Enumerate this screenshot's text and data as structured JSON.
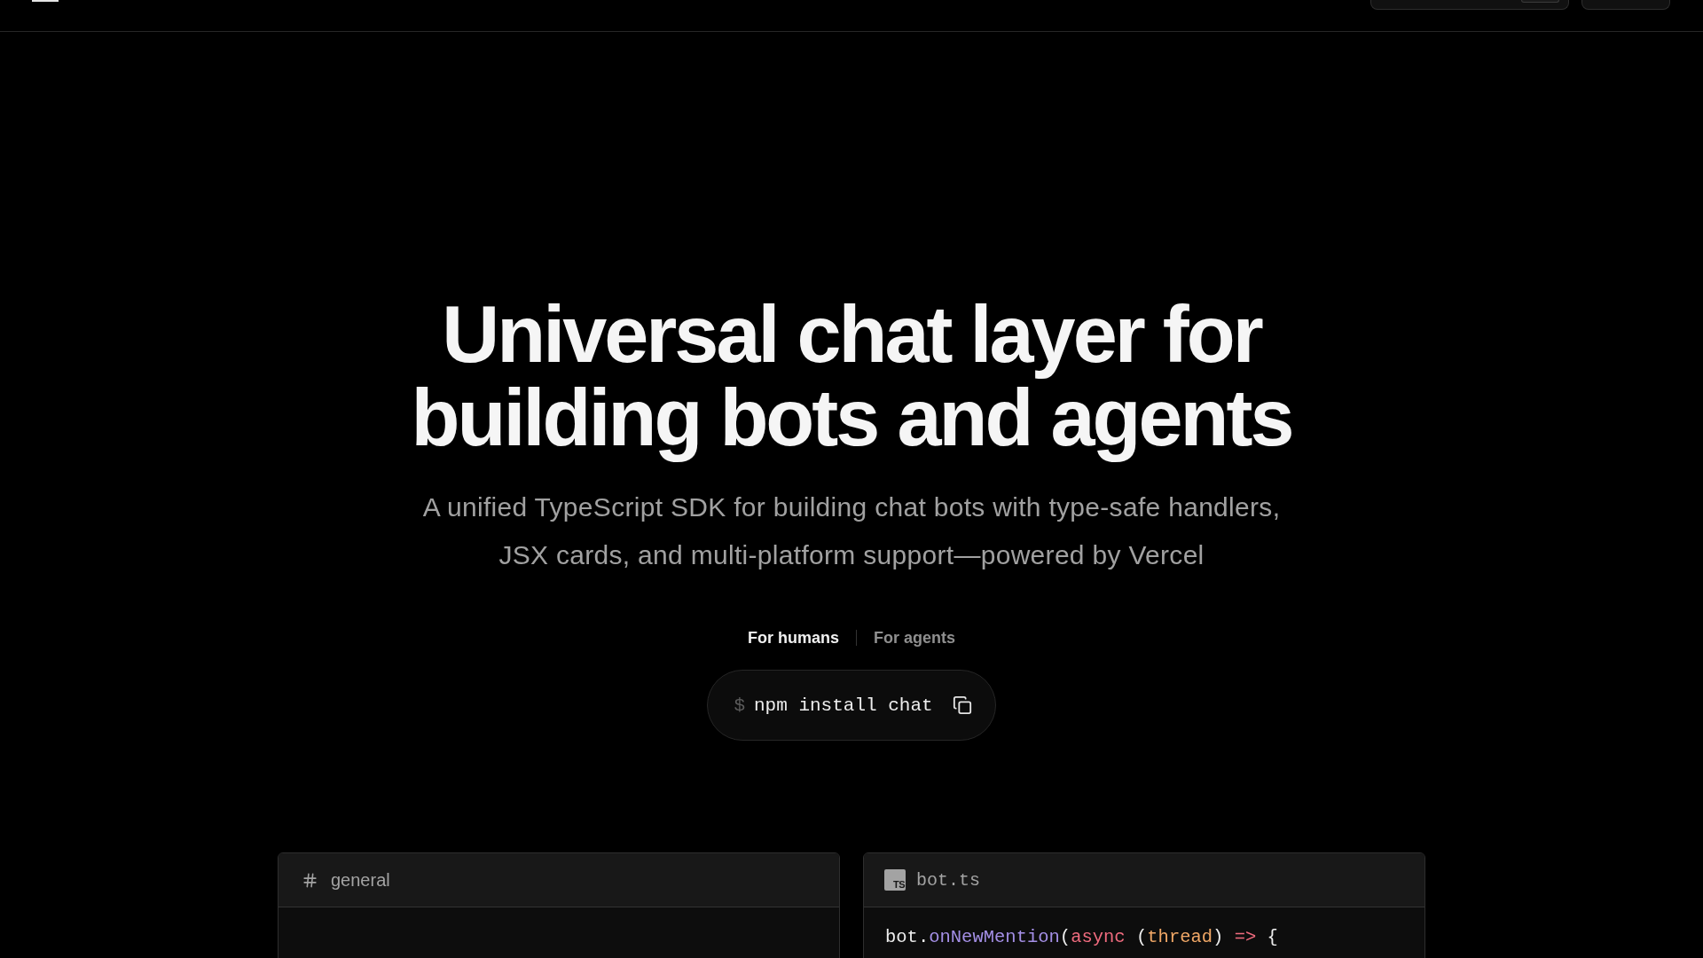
{
  "hero": {
    "title": "Universal chat layer for building bots and agents",
    "subtitle": "A unified TypeScript SDK for building chat bots with type-safe handlers, JSX cards, and multi-platform support—powered by Vercel"
  },
  "audience_tabs": [
    {
      "label": "For humans",
      "selected": true
    },
    {
      "label": "For agents",
      "selected": false
    }
  ],
  "install": {
    "prompt": "$",
    "command": "npm install chat"
  },
  "panels": [
    {
      "kind": "channel",
      "title": "general"
    },
    {
      "kind": "file",
      "badge": "TS",
      "title": "bot.ts",
      "code_lines": [
        {
          "tokens": [
            {
              "kind": "plain",
              "text": "bot."
            },
            {
              "kind": "function",
              "text": "onNewMention"
            },
            {
              "kind": "plain",
              "text": "("
            },
            {
              "kind": "keyword",
              "text": "async"
            },
            {
              "kind": "plain",
              "text": " ("
            },
            {
              "kind": "param",
              "text": "thread"
            },
            {
              "kind": "plain",
              "text": ") "
            },
            {
              "kind": "keyword",
              "text": "=>"
            },
            {
              "kind": "plain",
              "text": " {"
            }
          ]
        }
      ]
    }
  ]
}
